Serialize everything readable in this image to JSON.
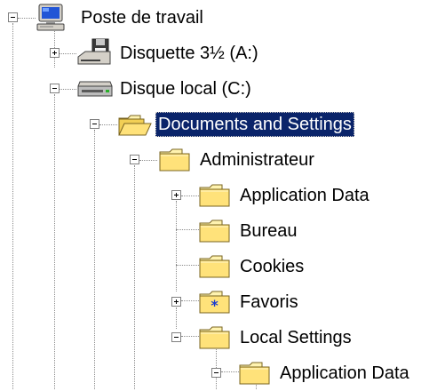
{
  "tree": {
    "nodes": [
      {
        "id": "poste-de-travail",
        "label": "Poste de travail",
        "icon": "my-computer-icon",
        "expander": "minus"
      },
      {
        "id": "disquette",
        "label": "Disquette 3½ (A:)",
        "icon": "floppy-drive-icon",
        "expander": "plus"
      },
      {
        "id": "disque-local",
        "label": "Disque local (C:)",
        "icon": "hard-drive-icon",
        "expander": "minus"
      },
      {
        "id": "documents-and-settings",
        "label": "Documents and Settings",
        "icon": "folder-open-icon",
        "expander": "minus",
        "selected": true
      },
      {
        "id": "administrateur",
        "label": "Administrateur",
        "icon": "folder-icon",
        "expander": "minus"
      },
      {
        "id": "application-data",
        "label": "Application Data",
        "icon": "folder-icon",
        "expander": "plus"
      },
      {
        "id": "bureau",
        "label": "Bureau",
        "icon": "folder-icon",
        "expander": null
      },
      {
        "id": "cookies",
        "label": "Cookies",
        "icon": "folder-icon",
        "expander": null
      },
      {
        "id": "favoris",
        "label": "Favoris",
        "icon": "favorites-folder-icon",
        "expander": "plus"
      },
      {
        "id": "local-settings",
        "label": "Local Settings",
        "icon": "folder-icon",
        "expander": "minus"
      },
      {
        "id": "local-application-data",
        "label": "Application Data",
        "icon": "folder-icon",
        "expander": "minus"
      }
    ]
  },
  "colors": {
    "selection_bg": "#0a246a",
    "selection_text": "#ffffff",
    "folder_yellow": "#ffe27a",
    "dotted_line": "#8c8c8c"
  }
}
